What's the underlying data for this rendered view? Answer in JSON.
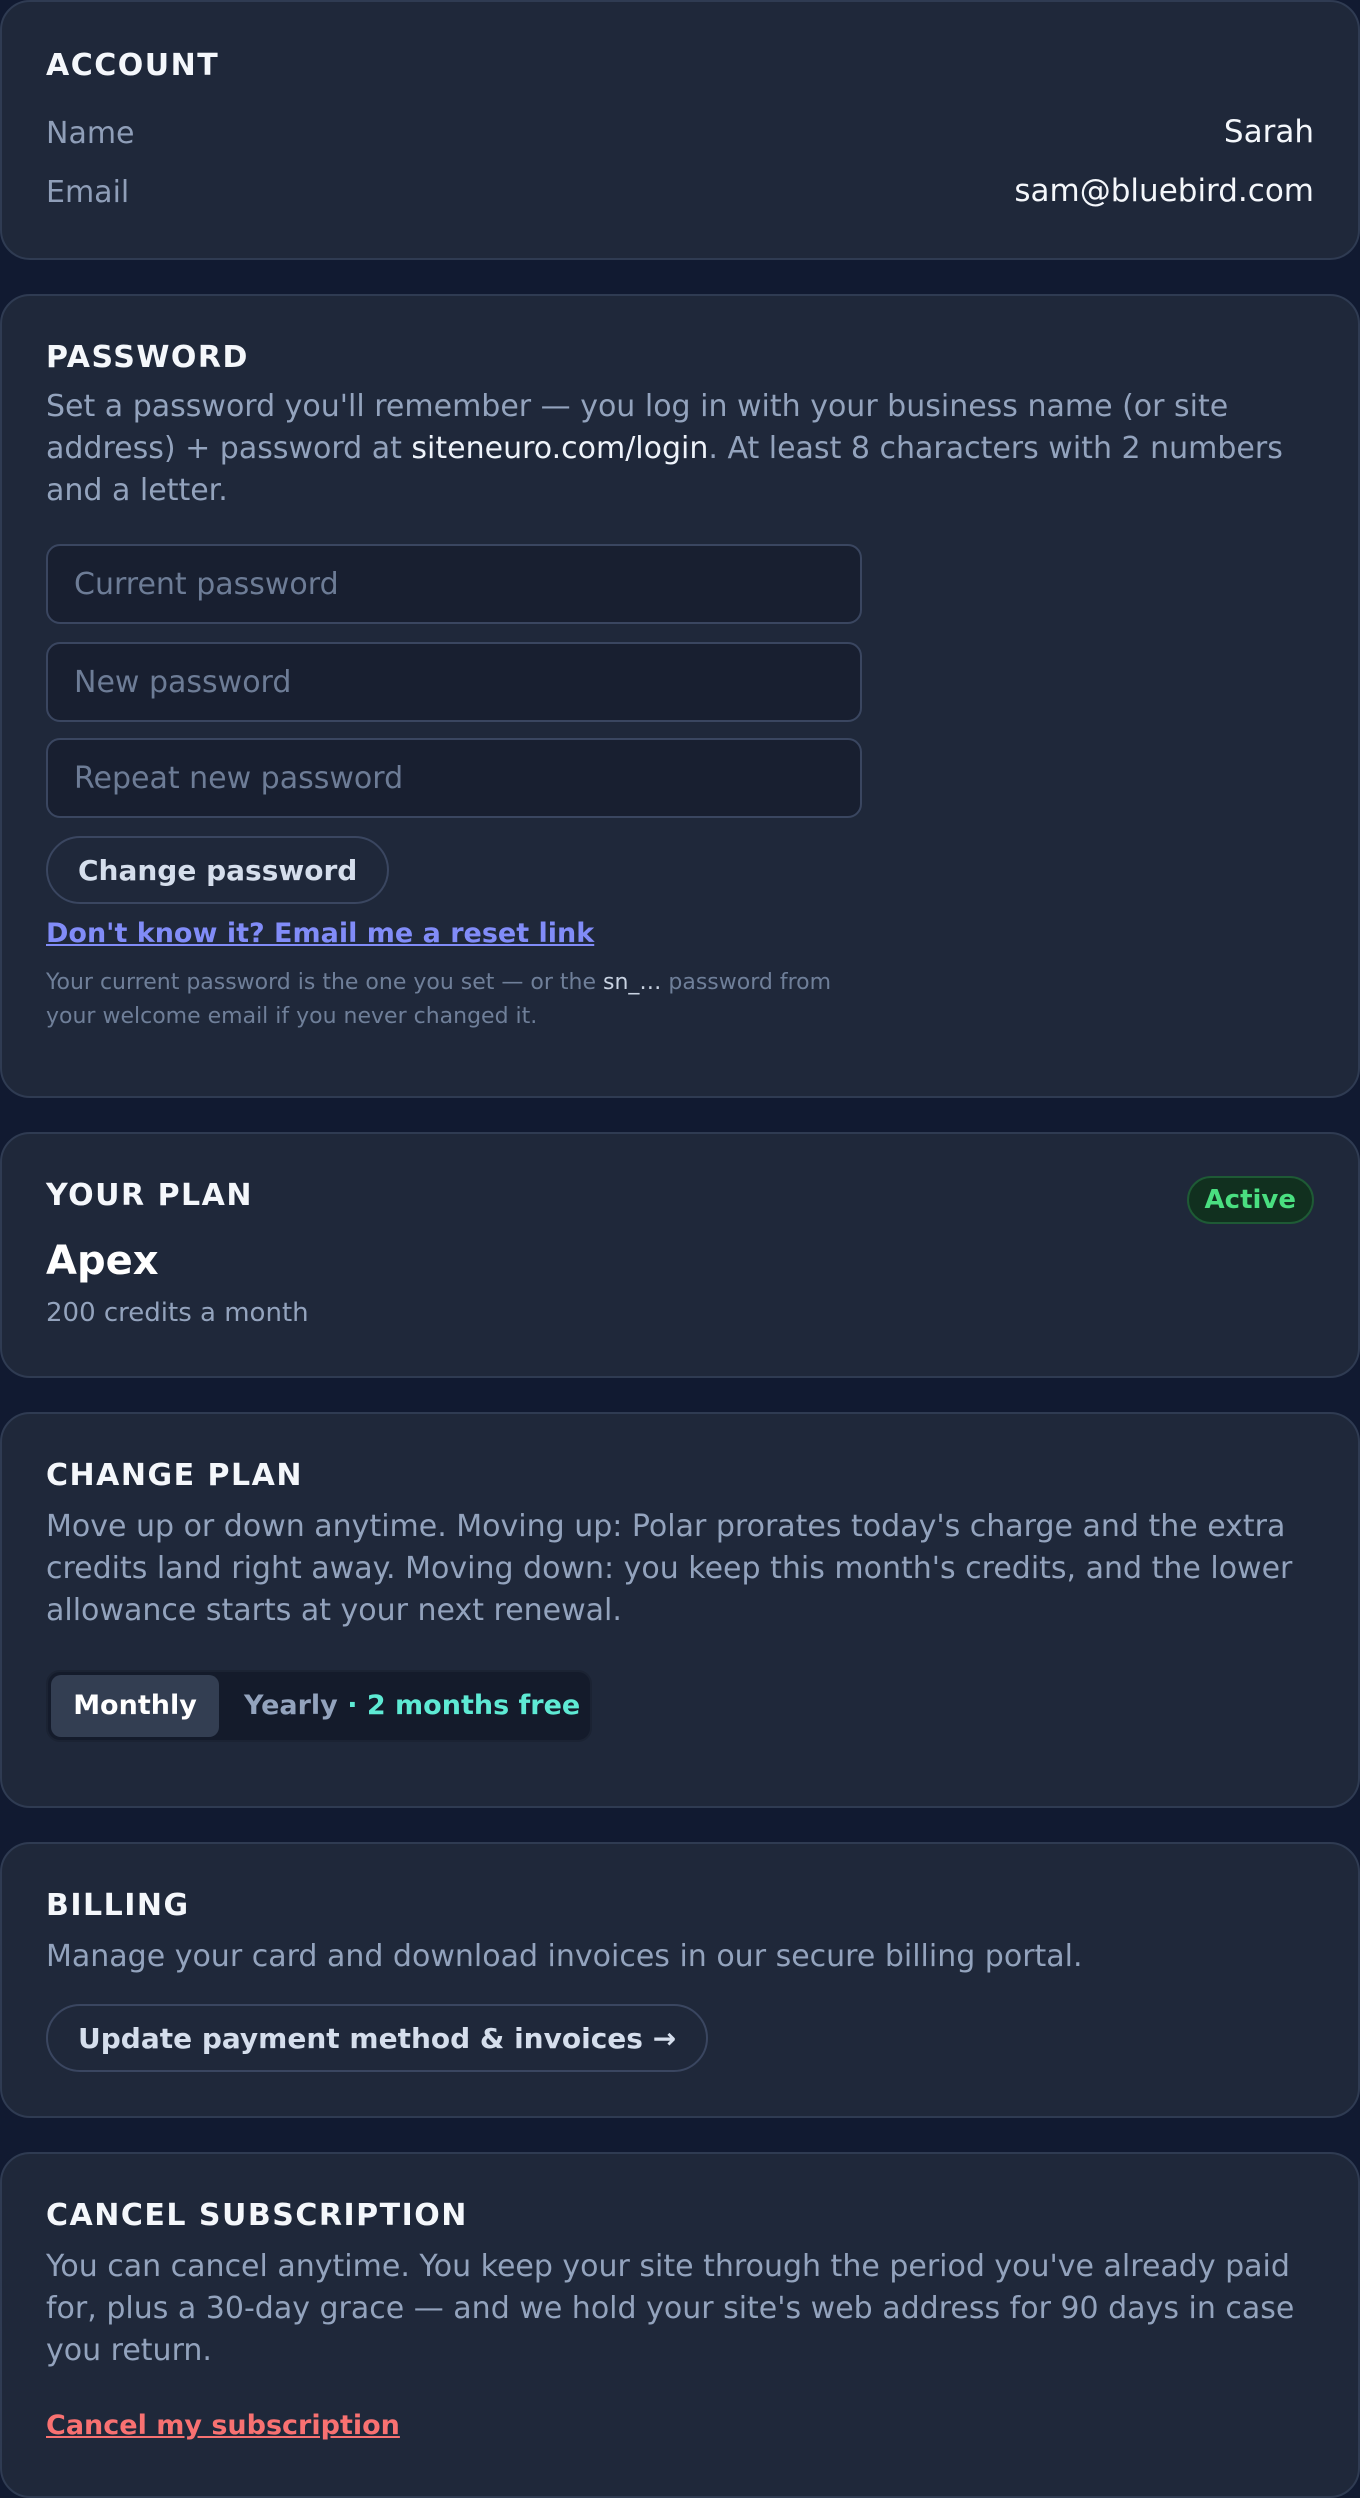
{
  "account": {
    "heading": "ACCOUNT",
    "name_label": "Name",
    "name_value": "Sarah",
    "email_label": "Email",
    "email_value": "sam@bluebird.com"
  },
  "password": {
    "heading": "PASSWORD",
    "desc_before": "Set a password you'll remember — you log in with your business name (or site address) + password at ",
    "desc_link": "siteneuro.com/login",
    "desc_after": ". At least 8 characters with 2 numbers and a letter.",
    "current_placeholder": "Current password",
    "new_placeholder": "New password",
    "repeat_placeholder": "Repeat new password",
    "change_button": "Change password",
    "reset_link": "Don't know it? Email me a reset link",
    "note_before": "Your current password is the one you set — or the ",
    "note_code": "sn_…",
    "note_after": " password from your welcome email if you never changed it."
  },
  "plan": {
    "heading": "YOUR PLAN",
    "status": "Active",
    "name": "Apex",
    "credits": "200 credits a month",
    "status_color": "#4ade80"
  },
  "change_plan": {
    "heading": "CHANGE PLAN",
    "desc": "Move up or down anytime. Moving up: Polar prorates today's charge and the extra credits land right away. Moving down: you keep this month's credits, and the lower allowance starts at your next renewal.",
    "toggle": {
      "monthly": "Monthly",
      "yearly": "Yearly",
      "separator": "·",
      "promo": "2 months free",
      "selected": "Monthly"
    }
  },
  "billing": {
    "heading": "BILLING",
    "desc": "Manage your card and download invoices in our secure billing portal.",
    "button": "Update payment method & invoices →"
  },
  "cancel": {
    "heading": "CANCEL SUBSCRIPTION",
    "desc": "You can cancel anytime. You keep your site through the period you've already paid for, plus a 30-day grace — and we hold your site's web address for 90 days in case you return.",
    "link": "Cancel my subscription",
    "link_color": "#f87171"
  },
  "colors": {
    "background": "#111a31",
    "card": "#1f283a",
    "accent_link": "#818cf8",
    "promo": "#5eead4"
  }
}
